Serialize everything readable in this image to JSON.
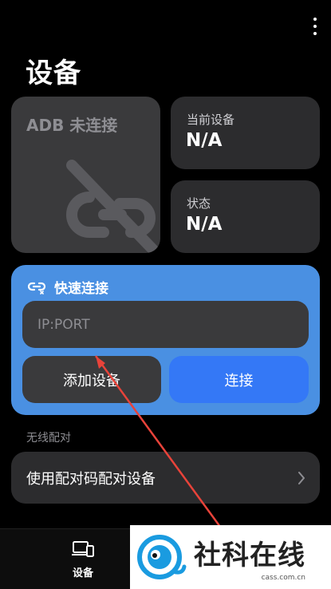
{
  "header": {
    "title": "设备",
    "menu_icon": "more-vertical-icon"
  },
  "adb_card": {
    "label": "ADB 未连接",
    "icon": "link-off-icon"
  },
  "current_device": {
    "label": "当前设备",
    "value": "N/A"
  },
  "status": {
    "label": "状态",
    "value": "N/A"
  },
  "quick_connect": {
    "icon": "link-icon",
    "title": "快速连接",
    "input_placeholder": "IP:PORT",
    "input_value": "",
    "add_label": "添加设备",
    "connect_label": "连接"
  },
  "wireless_pairing": {
    "section_label": "无线配对",
    "pair_label": "使用配对码配对设备",
    "chevron_icon": "chevron-right-icon"
  },
  "bottom_nav": {
    "items": [
      {
        "label": "设备",
        "icon": "devices-icon"
      }
    ]
  },
  "watermark": {
    "title": "社科在线",
    "domain": "cass.com.cn"
  },
  "colors": {
    "background": "#000000",
    "card": "#2c2c2e",
    "quick_card": "#4a90e2",
    "connect_button": "#3478f6",
    "annotation_arrow": "#e8433a"
  }
}
